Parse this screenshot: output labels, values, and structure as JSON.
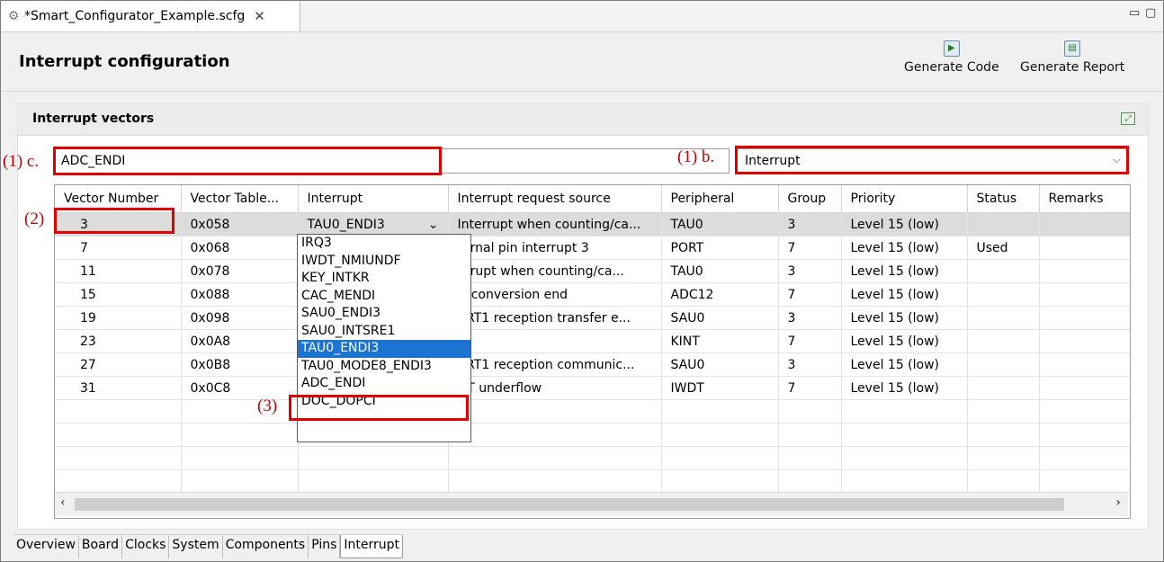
{
  "editor": {
    "tab_title": "*Smart_Configurator_Example.scfg",
    "close_glyph": "✕",
    "minimize_glyph": "▭",
    "maximize_glyph": "▢"
  },
  "header": {
    "title": "Interrupt configuration",
    "generate_code": "Generate Code",
    "generate_report": "Generate Report"
  },
  "section": {
    "title": "Interrupt vectors"
  },
  "filter": {
    "value": "ADC_ENDI"
  },
  "type_select": {
    "value": "Interrupt"
  },
  "annotations": {
    "c": "(1) c.",
    "b": "(1) b.",
    "two": "(2)",
    "three": "(3)"
  },
  "table": {
    "columns": [
      "Vector Number",
      "Vector Table...",
      "Interrupt",
      "Interrupt request source",
      "Peripheral",
      "Group",
      "Priority",
      "Status",
      "Remarks"
    ],
    "rows": [
      [
        "3",
        "0x058",
        "TAU0_ENDI3",
        "Interrupt when counting/ca...",
        "TAU0",
        "3",
        "Level 15 (low)",
        "",
        ""
      ],
      [
        "7",
        "0x068",
        "",
        "ternal pin interrupt 3",
        "PORT",
        "7",
        "Level 15 (low)",
        "Used",
        ""
      ],
      [
        "11",
        "0x078",
        "",
        "errupt when counting/ca...",
        "TAU0",
        "3",
        "Level 15 (low)",
        "",
        ""
      ],
      [
        "15",
        "0x088",
        "",
        "D conversion end",
        "ADC12",
        "7",
        "Level 15 (low)",
        "",
        ""
      ],
      [
        "19",
        "0x098",
        "",
        "ART1 reception transfer e...",
        "SAU0",
        "3",
        "Level 15 (low)",
        "",
        ""
      ],
      [
        "23",
        "0x0A8",
        "",
        "",
        "KINT",
        "7",
        "Level 15 (low)",
        "",
        ""
      ],
      [
        "27",
        "0x0B8",
        "",
        "ART1 reception communic...",
        "SAU0",
        "3",
        "Level 15 (low)",
        "",
        ""
      ],
      [
        "31",
        "0x0C8",
        "",
        "DT underflow",
        "IWDT",
        "7",
        "Level 15 (low)",
        "",
        ""
      ],
      [
        "",
        "",
        "",
        "",
        "",
        "",
        "",
        "",
        ""
      ],
      [
        "",
        "",
        "",
        "",
        "",
        "",
        "",
        "",
        ""
      ],
      [
        "",
        "",
        "",
        "",
        "",
        "",
        "",
        "",
        ""
      ],
      [
        "",
        "",
        "",
        "",
        "",
        "",
        "",
        "",
        ""
      ]
    ]
  },
  "dropdown": {
    "selected": "TAU0_ENDI3",
    "items": [
      "IRQ3",
      "IWDT_NMIUNDF",
      "KEY_INTKR",
      "CAC_MENDI",
      "SAU0_ENDI3",
      "SAU0_INTSRE1",
      "TAU0_ENDI3",
      "TAU0_MODE8_ENDI3",
      "ADC_ENDI",
      "DOC_DOPCI"
    ]
  },
  "bottom_tabs": [
    "Overview",
    "Board",
    "Clocks",
    "System",
    "Components",
    "Pins",
    "Interrupt"
  ],
  "colors": {
    "annotation_red": "#e00000",
    "selection_blue": "#1c73d1"
  }
}
